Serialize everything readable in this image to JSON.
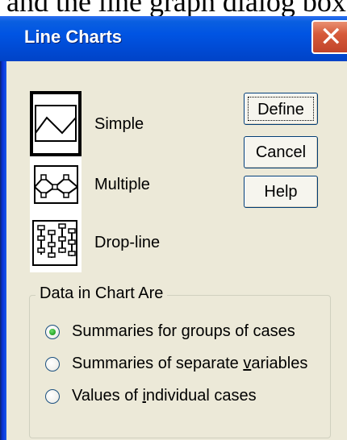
{
  "page_caption": "and the line graph dialog box",
  "window": {
    "title": "Line Charts",
    "close_glyph": "✕",
    "title_bar_color": "#0054e3",
    "close_button_color": "#d65a3a"
  },
  "chart_types": [
    {
      "label": "Simple",
      "icon": "simple-line-chart-icon",
      "selected": true
    },
    {
      "label": "Multiple",
      "icon": "multiple-line-chart-icon",
      "selected": false
    },
    {
      "label": "Drop-line",
      "icon": "drop-line-chart-icon",
      "selected": false
    }
  ],
  "buttons": {
    "define": "Define",
    "cancel": "Cancel",
    "help": "Help"
  },
  "data_group": {
    "title": "Data in Chart Are",
    "options": [
      {
        "before": "Summaries for ",
        "mnemonic": "g",
        "after": "roups of cases",
        "selected": true
      },
      {
        "before": "Summaries of separate ",
        "mnemonic": "v",
        "after": "ariables",
        "selected": false
      },
      {
        "before": "Values of ",
        "mnemonic": "i",
        "after": "ndividual cases",
        "selected": false
      }
    ]
  }
}
